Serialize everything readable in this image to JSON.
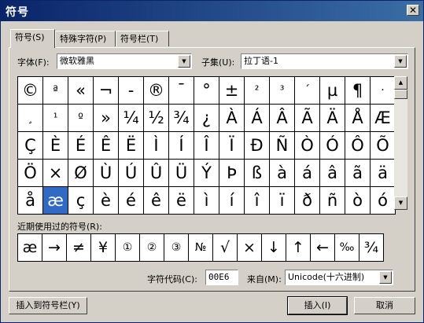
{
  "window": {
    "title": "符号",
    "close_glyph": "✕"
  },
  "tabs": [
    {
      "label": "符号(S)"
    },
    {
      "label": "特殊字符(P)"
    },
    {
      "label": "符号栏(T)"
    }
  ],
  "font": {
    "label": "字体(F):",
    "value": "微软雅黑"
  },
  "subset": {
    "label": "子集(U):",
    "value": "拉丁语-1"
  },
  "symbols": [
    "©",
    "ª",
    "«",
    "¬",
    "-",
    "®",
    "¯",
    "°",
    "±",
    "²",
    "³",
    "´",
    "µ",
    "¶",
    "·",
    "¸",
    "¹",
    "º",
    "»",
    "¼",
    "½",
    "¾",
    "¿",
    "À",
    "Á",
    "Â",
    "Ã",
    "Ä",
    "Å",
    "Æ",
    "Ç",
    "È",
    "É",
    "Ê",
    "Ë",
    "Ì",
    "Í",
    "Î",
    "Ï",
    "Ð",
    "Ñ",
    "Ò",
    "Ó",
    "Ô",
    "Õ",
    "Ö",
    "×",
    "Ø",
    "Ù",
    "Ú",
    "Û",
    "Ü",
    "Ý",
    "Þ",
    "ß",
    "à",
    "á",
    "â",
    "ã",
    "ä",
    "å",
    "æ",
    "ç",
    "è",
    "é",
    "ê",
    "ë",
    "ì",
    "í",
    "î",
    "ï",
    "ð",
    "ñ",
    "ò",
    "ó"
  ],
  "selected_index": 61,
  "recent": {
    "label": "近期使用过的符号(R):",
    "items": [
      "æ",
      "→",
      "≠",
      "¥",
      "①",
      "②",
      "③",
      "№",
      "√",
      "×",
      "↓",
      "↑",
      "←",
      "‰",
      "¾"
    ]
  },
  "char_code": {
    "label": "字符代码(C):",
    "value": "00E6"
  },
  "from": {
    "label": "来自(M):",
    "value": "Unicode(十六进制)"
  },
  "buttons": {
    "insert_to_toolbar": "插入到符号栏(Y)",
    "insert": "插入(I)",
    "cancel": "取消"
  },
  "icons": {
    "dropdown": "down-arrow-icon",
    "scroll_up": "up-arrow-icon",
    "scroll_down": "down-arrow-icon"
  }
}
